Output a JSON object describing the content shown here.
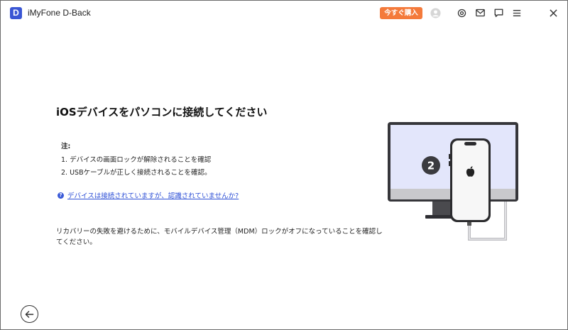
{
  "window": {
    "logo_letter": "D",
    "title": "iMyFone D-Back",
    "buy_label": "今すぐ購入",
    "icons": [
      "user-avatar-icon",
      "settings-icon",
      "mail-icon",
      "chat-icon",
      "menu-icon",
      "close-icon"
    ]
  },
  "main": {
    "title": "iOSデバイスをパソコンに接続してください",
    "note_label": "注:",
    "notes": [
      "1. デバイスの画面ロックが解除されることを確認",
      "2. USBケーブルが正しく接続されることを確認。"
    ],
    "help_icon": "?",
    "help_link": "デバイスは接続されていますが、認識されていませんか?",
    "mdm_text": "リカバリーの失敗を避けるために、モバイルデバイス管理（MDM）ロックがオフになっていることを確認してください。"
  },
  "illustration": {
    "step_number": "2",
    "monitor_screen_color": "#e3e6fb",
    "accent_color": "#3a56d4"
  },
  "footer": {
    "back_icon": "back-arrow-icon"
  }
}
